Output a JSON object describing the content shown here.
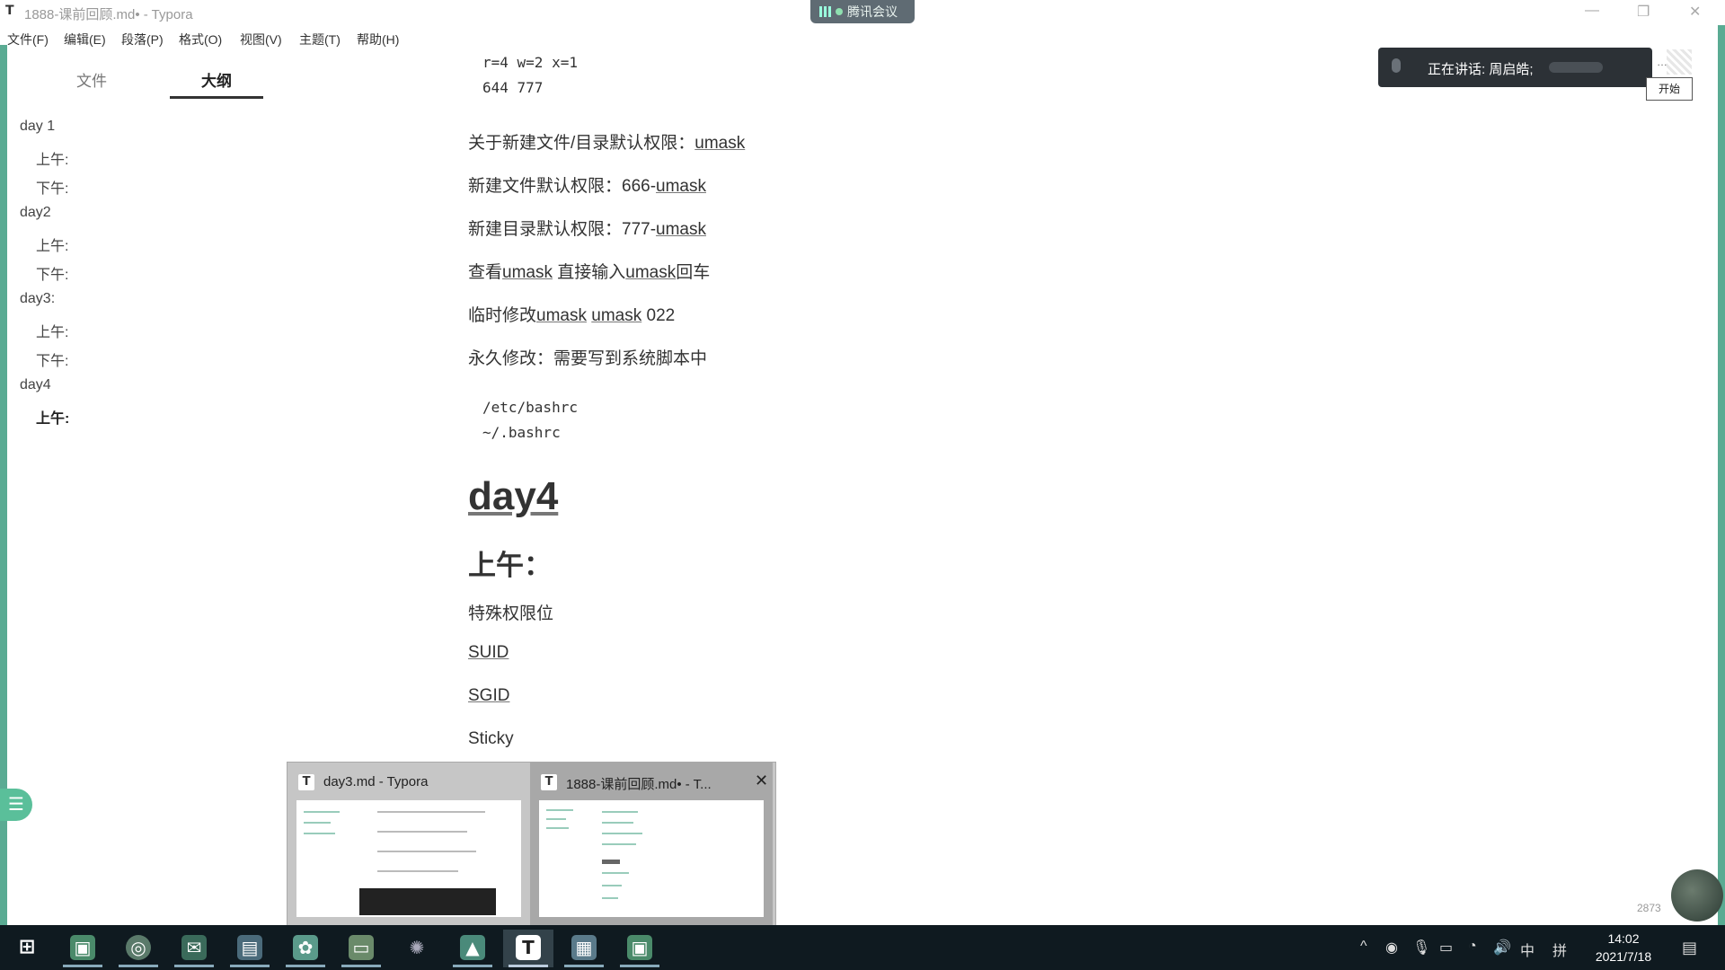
{
  "window": {
    "app_icon": "T",
    "title": "1888-课前回顾.md• - Typora",
    "controls": [
      "—",
      "❐",
      "✕"
    ]
  },
  "meeting": {
    "label": "腾讯会议",
    "speaking_text": "正在讲话: 周启皓;",
    "start_button": "开始",
    "dots": "…",
    "counter": "2873"
  },
  "menu": [
    "文件(F)",
    "编辑(E)",
    "段落(P)",
    "格式(O)",
    "视图(V)",
    "主题(T)",
    "帮助(H)"
  ],
  "sidebar": {
    "tabs": [
      "文件",
      "大纲"
    ],
    "active_tab": "大纲",
    "outline": [
      {
        "text": "day 1",
        "level": 1
      },
      {
        "text": "上午:",
        "level": 2
      },
      {
        "text": "下午:",
        "level": 2
      },
      {
        "text": "day2",
        "level": 1
      },
      {
        "text": "上午:",
        "level": 2
      },
      {
        "text": "下午:",
        "level": 2
      },
      {
        "text": "day3:",
        "level": 1
      },
      {
        "text": "上午:",
        "level": 2
      },
      {
        "text": "下午:",
        "level": 2
      },
      {
        "text": "day4",
        "level": 1
      },
      {
        "text": "上午:",
        "level": 2,
        "active": true
      }
    ]
  },
  "editor": {
    "code1": [
      "r=4 w=2 x=1",
      "644 777"
    ],
    "p1": {
      "a": "关于新建文件/目录默认权限：",
      "u": "umask"
    },
    "p2": {
      "a": "新建文件默认权限：666-",
      "u": "umask"
    },
    "p3": {
      "a": "新建目录默认权限：777-",
      "u": "umask"
    },
    "p4": {
      "a": "查看",
      "u1": "umask",
      "b": " 直接输入",
      "u2": "umask",
      "c": "回车"
    },
    "p5": {
      "a": "临时修改",
      "u1": "umask",
      "b": " ",
      "u2": "umask",
      "c": " 022"
    },
    "p6": "永久修改：需要写到系统脚本中",
    "code2": [
      "/etc/bashrc",
      "~/.bashrc"
    ],
    "h1": "day4",
    "h2": "上午：",
    "p7": "特殊权限位",
    "p8": "SUID",
    "p9": "SGID",
    "p10": "Sticky"
  },
  "thumbnails": [
    {
      "icon": "T",
      "title": "day3.md - Typora"
    },
    {
      "icon": "T",
      "title": "1888-课前回顾.md• - T...",
      "close": "✕"
    }
  ],
  "taskbar": {
    "icons": [
      "windows-start",
      "screenshot-tool",
      "chrome",
      "wechat",
      "virtual-machine",
      "baidu-netdisk",
      "file-manager",
      "network-tool",
      "photos",
      "typora",
      "remote-desktop",
      "screenshot-tool-2"
    ],
    "tray": [
      "^",
      "◉",
      "🎙",
      "▭",
      "◔",
      "🔊",
      "中",
      "拼"
    ],
    "time": "14:02",
    "date": "2021/7/18",
    "notification": "▤"
  },
  "colors": {
    "accent_green": "#3d9c80",
    "taskbar_bg": "#0f1a20",
    "speaking_bg": "#2c3136"
  }
}
